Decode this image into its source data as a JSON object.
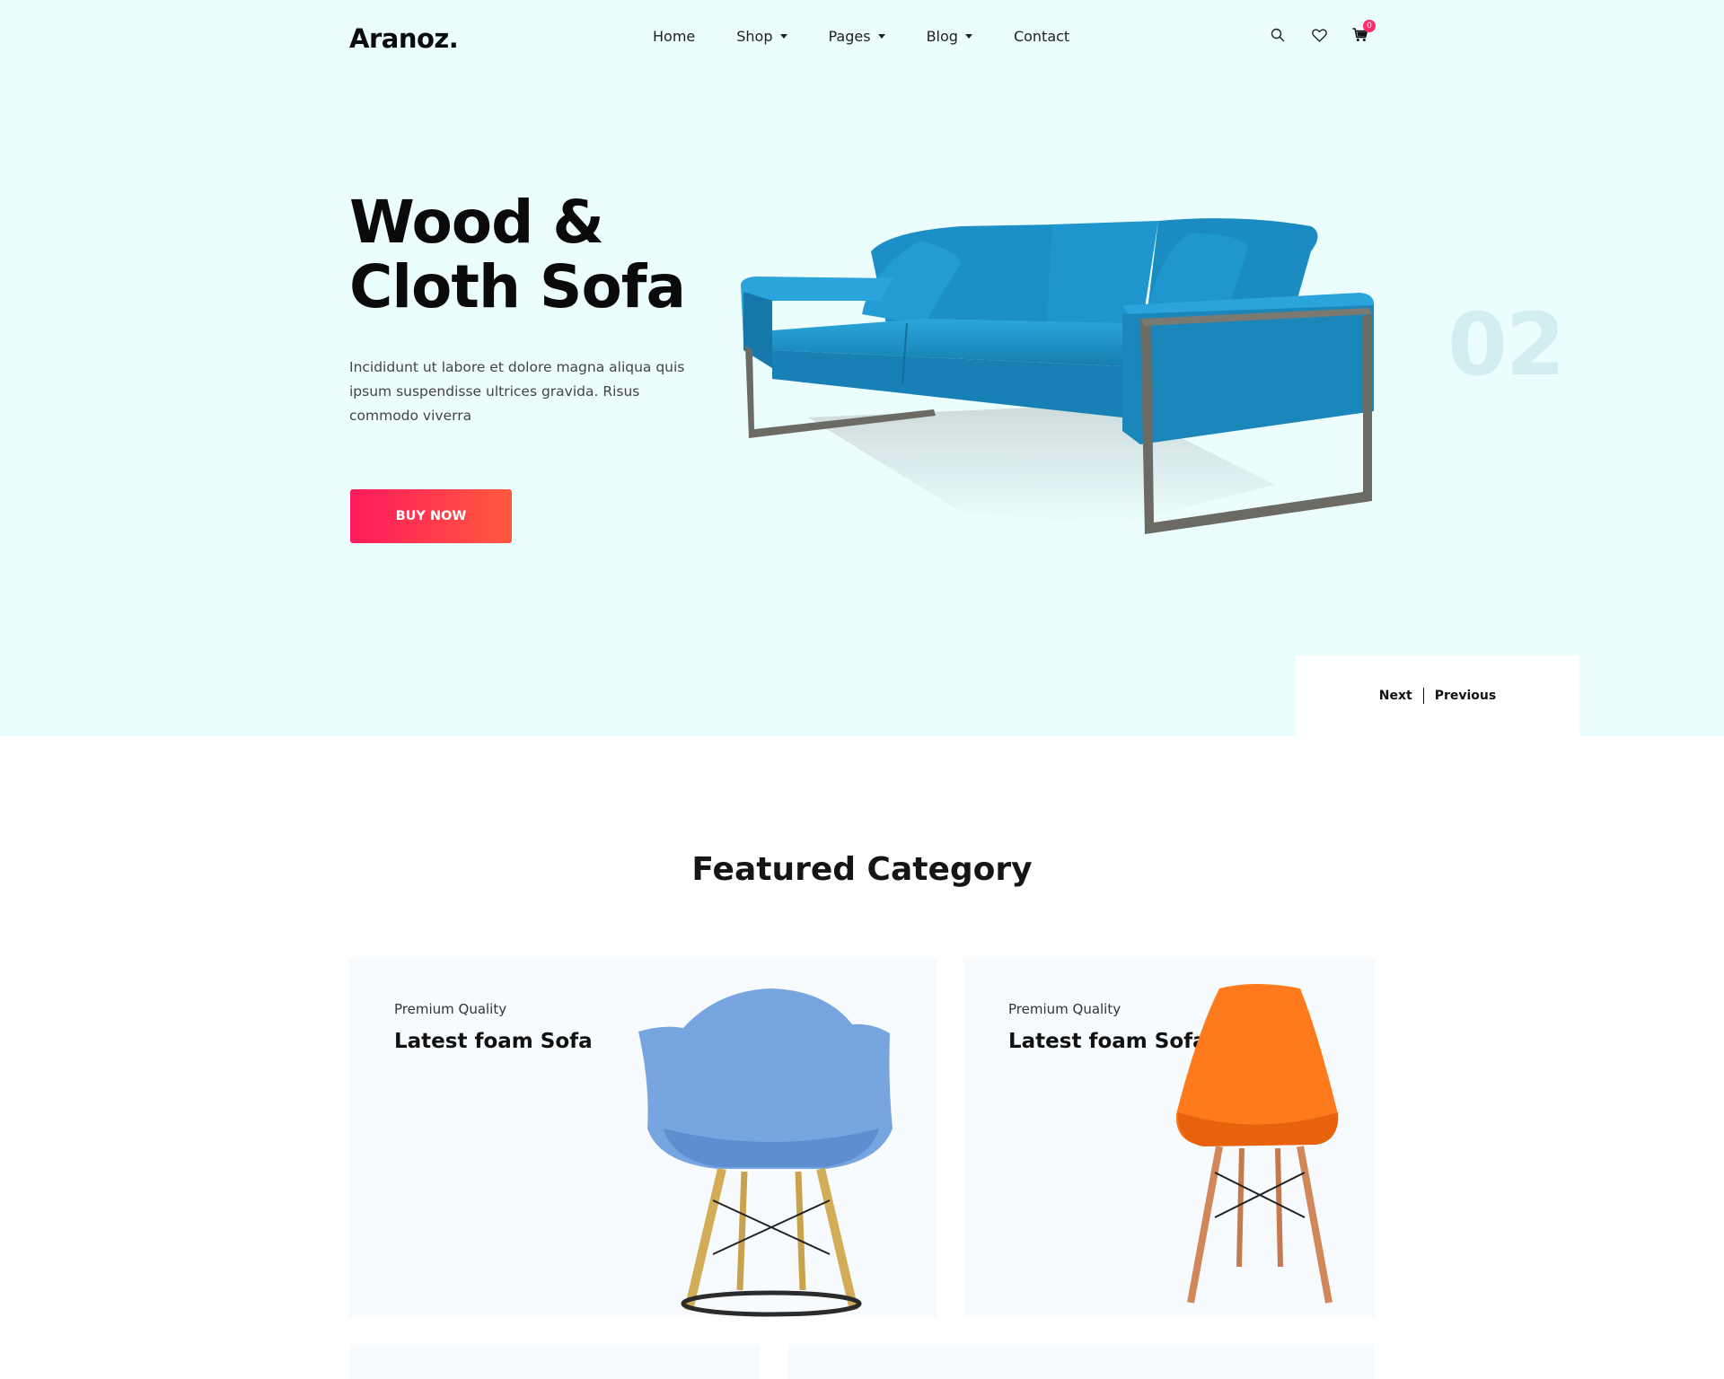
{
  "header": {
    "logo": "Aranoz.",
    "nav": [
      {
        "label": "Home",
        "dropdown": false
      },
      {
        "label": "Shop",
        "dropdown": true
      },
      {
        "label": "Pages",
        "dropdown": true
      },
      {
        "label": "Blog",
        "dropdown": true
      },
      {
        "label": "Contact",
        "dropdown": false
      }
    ],
    "icons": [
      "search-icon",
      "heart-icon",
      "cart-icon"
    ],
    "cart_count": "0"
  },
  "hero": {
    "title_line1": "Wood &",
    "title_line2": "Cloth Sofa",
    "description": "Incididunt ut labore et dolore magna aliqua quis ipsum suspendisse ultrices gravida. Risus commodo viverra",
    "button_label": "BUY NOW",
    "slide_number": "02",
    "next_label": "Next",
    "previous_label": "Previous"
  },
  "featured": {
    "title": "Featured Category",
    "cards": [
      {
        "eyebrow": "Premium Quality",
        "title": "Latest foam Sofa"
      },
      {
        "eyebrow": "Premium Quality",
        "title": "Latest foam Sofa"
      }
    ]
  },
  "colors": {
    "hero_bg": "#ecfdfe",
    "accent_start": "#ff1a5e",
    "accent_end": "#ff5a3c",
    "sofa": "#1a9ad0"
  }
}
